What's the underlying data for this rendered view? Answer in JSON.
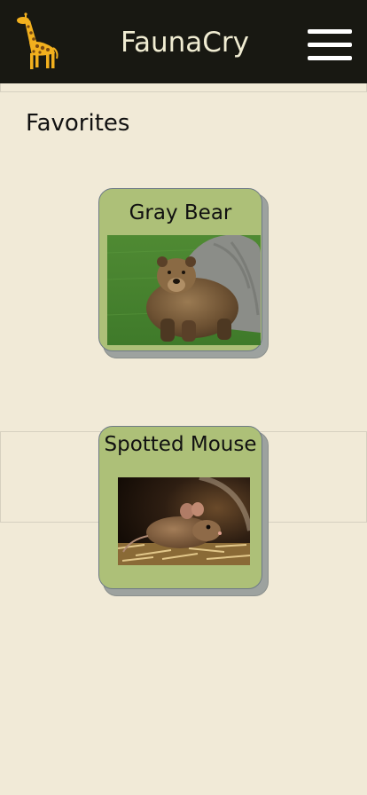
{
  "header": {
    "app_title": "FaunaCry",
    "logo_icon": "giraffe-icon",
    "menu_icon": "hamburger-menu-icon",
    "background_color": "#181812",
    "title_color": "#f0ecd2"
  },
  "main": {
    "section_heading": "Favorites",
    "background_color": "#f1ead7",
    "cards": [
      {
        "title": "Gray Bear",
        "image": "bear-photo"
      },
      {
        "title": "Spotted Mouse",
        "image": "mouse-photo"
      }
    ],
    "card_color": "#adc078"
  }
}
